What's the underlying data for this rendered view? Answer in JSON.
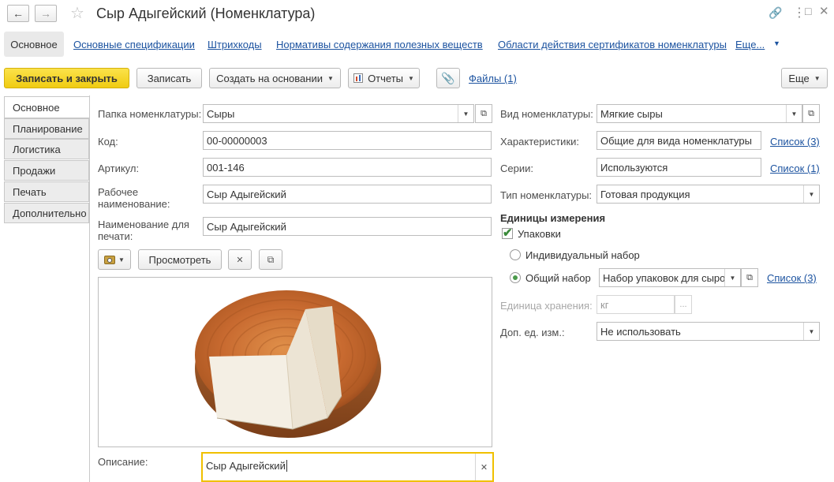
{
  "window": {
    "title": "Сыр Адыгейский (Номенклатура)"
  },
  "top_tabs": [
    {
      "label": "Основное",
      "active": true
    },
    {
      "label": "Основные спецификации"
    },
    {
      "label": "Штрихкоды"
    },
    {
      "label": "Нормативы содержания полезных веществ"
    },
    {
      "label": "Области действия сертификатов номенклатуры"
    },
    {
      "label": "Еще..."
    }
  ],
  "toolbar": {
    "save_close": "Записать и закрыть",
    "save": "Записать",
    "create_based": "Создать на основании",
    "reports": "Отчеты",
    "files": "Файлы (1)",
    "more": "Еще"
  },
  "side_tabs": [
    {
      "label": "Основное",
      "active": true
    },
    {
      "label": "Планирование"
    },
    {
      "label": "Логистика"
    },
    {
      "label": "Продажи"
    },
    {
      "label": "Печать"
    },
    {
      "label": "Дополнительно"
    }
  ],
  "left": {
    "folder_label": "Папка номенклатуры:",
    "folder_value": "Сыры",
    "code_label": "Код:",
    "code_value": "00-00000003",
    "article_label": "Артикул:",
    "article_value": "001-146",
    "work_name_label": "Рабочее наименование:",
    "work_name_value": "Сыр Адыгейский",
    "print_name_label": "Наименование для печати:",
    "print_name_value": "Сыр Адыгейский",
    "view_button": "Просмотреть",
    "description_label": "Описание:",
    "description_value": "Сыр Адыгейский"
  },
  "right": {
    "kind_label": "Вид номенклатуры:",
    "kind_value": "Мягкие сыры",
    "characteristics_label": "Характеристики:",
    "characteristics_value": "Общие для вида номенклатуры",
    "characteristics_link": "Список (3)",
    "series_label": "Серии:",
    "series_value": "Используются",
    "series_link": "Список (1)",
    "type_label": "Тип номенклатуры:",
    "type_value": "Готовая продукция",
    "units_header": "Единицы измерения",
    "packages_label": "Упаковки",
    "packages_checked": true,
    "individual_label": "Индивидуальный набор",
    "common_label": "Общий набор",
    "common_selected": true,
    "common_value": "Набор упаковок для сыро",
    "common_link": "Список (3)",
    "storage_unit_label": "Единица хранения:",
    "storage_unit_value": "кг",
    "extra_unit_label": "Доп. ед. изм.:",
    "extra_unit_value": "Не использовать"
  },
  "colors": {
    "primary_button": "#f5d52a",
    "link": "#1c53a0",
    "accent_focus": "#f0c000",
    "checkbox_green": "#3a8a3a"
  }
}
